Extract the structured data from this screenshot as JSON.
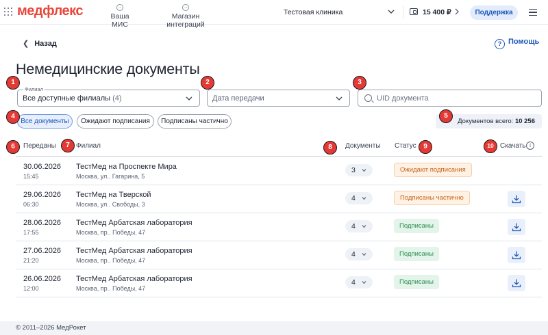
{
  "header": {
    "logo_text": "медфлекс",
    "nav": [
      {
        "label": "Ваша МИС",
        "icon": "login-icon"
      },
      {
        "label": "Магазин интеграций",
        "icon": "logout-icon"
      }
    ],
    "clinic": "Тестовая клиника",
    "balance": "15 400 ₽",
    "support_label": "Поддержка"
  },
  "back_label": "Назад",
  "help_label": "Помощь",
  "page_title": "Немедицинские документы",
  "filters": {
    "branch": {
      "label": "Филиал",
      "value": "Все доступные филиалы",
      "count": "(4)"
    },
    "date": {
      "placeholder": "Дата передачи"
    },
    "uid": {
      "placeholder": "UID документа"
    }
  },
  "chips": [
    {
      "label": "Все документы",
      "active": true
    },
    {
      "label": "Ожидают подписания",
      "active": false
    },
    {
      "label": "Подписаны частично",
      "active": false
    }
  ],
  "total": {
    "label": "Документов всего:",
    "value": "10 256"
  },
  "table": {
    "headers": {
      "date": "Переданы",
      "branch": "Филиал",
      "docs": "Документы",
      "status": "Статус",
      "download": "Скачать"
    },
    "rows": [
      {
        "date": "30.06.2026",
        "time": "15:45",
        "branch": "ТестМед на Проспекте Мира",
        "address": "Москва, ул.. Гагарина, 5",
        "docs": "3",
        "status": "Ожидают подписания",
        "status_kind": "wait",
        "download": false
      },
      {
        "date": "29.06.2026",
        "time": "06:30",
        "branch": "ТестМед на Тверской",
        "address": "Москва, ул.. Свободы, 3",
        "docs": "4",
        "status": "Подписаны частично",
        "status_kind": "part",
        "download": true
      },
      {
        "date": "28.06.2026",
        "time": "17:55",
        "branch": "ТестМед Арбатская лаборатория",
        "address": "Москва, пр.. Победы, 47",
        "docs": "4",
        "status": "Подписаны",
        "status_kind": "ok",
        "download": true
      },
      {
        "date": "27.06.2026",
        "time": "21:20",
        "branch": "ТестМед Арбатская лаборатория",
        "address": "Москва, пр.. Победы, 47",
        "docs": "4",
        "status": "Подписаны",
        "status_kind": "ok",
        "download": true
      },
      {
        "date": "26.06.2026",
        "time": "12:00",
        "branch": "ТестМед Арбатская лаборатория",
        "address": "Москва, пр.. Победы, 47",
        "docs": "4",
        "status": "Подписаны",
        "status_kind": "ok",
        "download": true
      }
    ]
  },
  "footer": "© 2011–2026 МедРокет",
  "markers": [
    "1",
    "2",
    "3",
    "4",
    "5",
    "6",
    "7",
    "8",
    "9",
    "10"
  ],
  "colors": {
    "brand_red": "#e8473b",
    "brand_blue": "#1e6fd9",
    "accent": "#1e57b8",
    "marker": "#e53935",
    "status_wait": "#c4641a",
    "status_ok": "#2b8a4e"
  }
}
